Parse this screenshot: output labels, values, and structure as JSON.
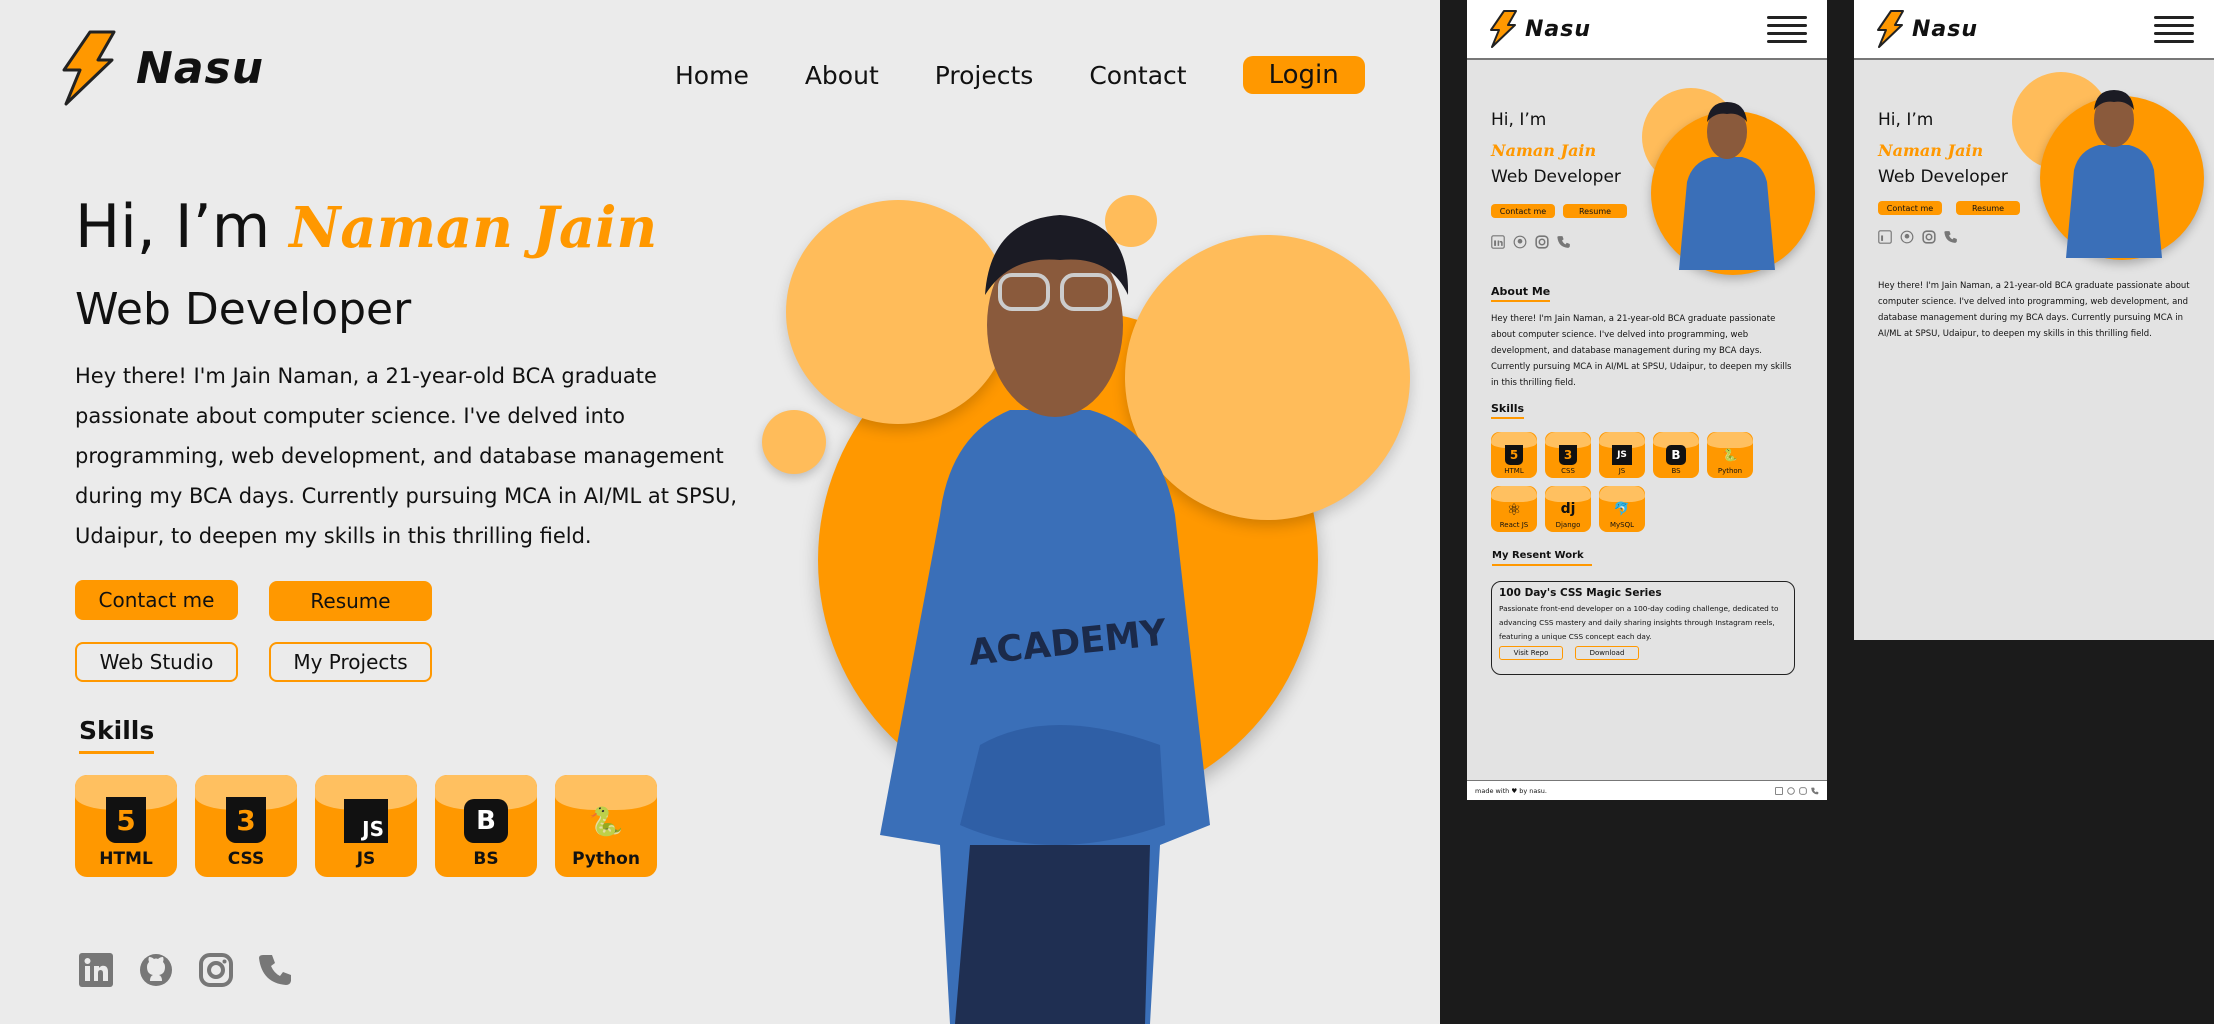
{
  "brand": {
    "name": "Nasu",
    "logo_icon": "lightning-bolt-icon"
  },
  "nav": {
    "items": [
      "Home",
      "About",
      "Projects",
      "Contact"
    ],
    "login": "Login"
  },
  "hero": {
    "greeting": "Hi, I’m",
    "name": "Naman Jain",
    "role": "Web Developer",
    "bio": "Hey there! I'm Jain Naman, a 21-year-old BCA graduate passionate about computer science. I've delved into programming, web development, and database management during my BCA days. Currently pursuing MCA in AI/ML at SPSU, Udaipur, to deepen my skills in this thrilling field.",
    "buttons": {
      "contact": "Contact me",
      "resume": "Resume",
      "studio": "Web Studio",
      "projects": "My Projects"
    }
  },
  "skills": {
    "title": "Skills",
    "items": [
      {
        "label": "HTML",
        "icon": "html5-icon",
        "glyph": "5"
      },
      {
        "label": "CSS",
        "icon": "css3-icon",
        "glyph": "3"
      },
      {
        "label": "JS",
        "icon": "js-icon",
        "glyph": "JS"
      },
      {
        "label": "BS",
        "icon": "bootstrap-icon",
        "glyph": "B"
      },
      {
        "label": "Python",
        "icon": "python-icon",
        "glyph": "🐍"
      },
      {
        "label": "React JS",
        "icon": "react-icon",
        "glyph": "⚛"
      },
      {
        "label": "Django",
        "icon": "django-icon",
        "glyph": "dj"
      },
      {
        "label": "MySQL",
        "icon": "mysql-icon",
        "glyph": "🐬"
      }
    ]
  },
  "social": [
    "linkedin-icon",
    "github-icon",
    "instagram-icon",
    "phone-icon"
  ],
  "mobile": {
    "about_title": "About Me",
    "about_text": "Hey there! I'm Jain Naman, a 21-year-old BCA graduate passionate about computer science. I've delved into programming, web development, and database management during my BCA days. Currently pursuing MCA in AI/ML at SPSU, Udaipur, to deepen my skills in this thrilling field.",
    "work_title": "My Resent Work",
    "work": {
      "title": "100 Day's CSS Magic Series",
      "desc": "Passionate front-end developer on a 100-day coding challenge, dedicated to advancing CSS mastery and daily sharing insights through Instagram reels, featuring a unique CSS concept each day.",
      "btn1": "Visit Repo",
      "btn2": "Download"
    },
    "footer": "made with ♥ by nasu."
  },
  "colors": {
    "accent": "#ff9800",
    "accent_light": "#ffc060",
    "bg": "#ebebeb",
    "dark": "#1b1b1b"
  }
}
